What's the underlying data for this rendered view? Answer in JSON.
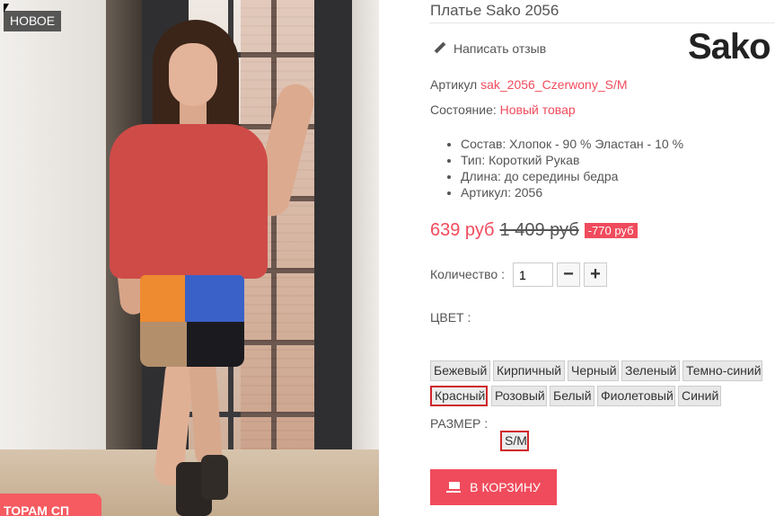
{
  "product": {
    "title": "Платье Sako 2056",
    "brand_logo": "Sako",
    "new_badge": "НОВОЕ",
    "promo_tab": "ТОРАМ СП",
    "review_link": "Написать отзыв",
    "sku_label": "Артикул",
    "sku_value": "sak_2056_Czerwony_S/M",
    "condition_label": "Состояние:",
    "condition_value": "Новый товар",
    "features": [
      "Состав: Хлопок - 90 % Эластан - 10 %",
      "Тип: Короткий Рукав",
      "Длина: до середины бедра",
      "Артикул: 2056"
    ]
  },
  "price": {
    "current": "639 руб",
    "old": "1 409 руб",
    "discount": "-770 руб"
  },
  "quantity": {
    "label": "Количество :",
    "value": "1",
    "minus": "−",
    "plus": "+"
  },
  "color": {
    "label": "ЦВЕТ :",
    "options": [
      "Бежевый",
      "Кирпичный",
      "Черный",
      "Зеленый",
      "Темно-синий",
      "Красный",
      "Розовый",
      "Белый",
      "Фиолетовый",
      "Синий"
    ],
    "selected": "Красный"
  },
  "size": {
    "label": "РАЗМЕР :",
    "options": [
      "S/M"
    ],
    "selected": "S/M"
  },
  "cart_button": "В КОРЗИНУ",
  "colors": {
    "accent": "#f04b5c",
    "selected_border": "#d0262b"
  }
}
